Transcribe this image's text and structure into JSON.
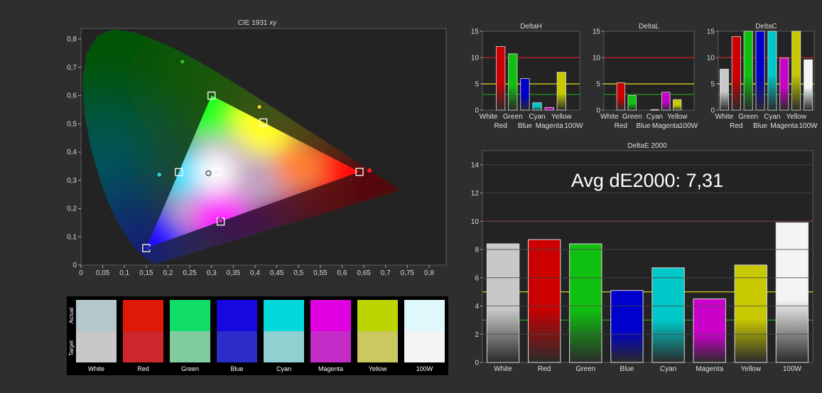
{
  "chart_data": [
    {
      "id": "cie",
      "type": "scatter",
      "title": "CIE 1931 xy",
      "xlim": [
        0,
        0.8
      ],
      "ylim": [
        0,
        0.85
      ],
      "x_ticks": [
        "0",
        "0,05",
        "0,1",
        "0,15",
        "0,2",
        "0,25",
        "0,3",
        "0,35",
        "0,4",
        "0,45",
        "0,5",
        "0,55",
        "0,6",
        "0,65",
        "0,7",
        "0,75",
        "0,8"
      ],
      "y_ticks": [
        "0",
        "0,1",
        "0,2",
        "0,3",
        "0,4",
        "0,5",
        "0,6",
        "0,7",
        "0,8"
      ],
      "gamut_triangle": [
        [
          0.64,
          0.33
        ],
        [
          0.3,
          0.6
        ],
        [
          0.15,
          0.06
        ]
      ],
      "targets": [
        {
          "name": "Red",
          "x": 0.64,
          "y": 0.33
        },
        {
          "name": "Green",
          "x": 0.3,
          "y": 0.6
        },
        {
          "name": "Blue",
          "x": 0.15,
          "y": 0.06
        },
        {
          "name": "Cyan",
          "x": 0.225,
          "y": 0.329
        },
        {
          "name": "Magenta",
          "x": 0.321,
          "y": 0.154
        },
        {
          "name": "Yellow",
          "x": 0.419,
          "y": 0.505
        },
        {
          "name": "White",
          "x": 0.3127,
          "y": 0.329
        }
      ],
      "measured": [
        {
          "name": "Red",
          "x": 0.663,
          "y": 0.335,
          "color": "#ff2020"
        },
        {
          "name": "Green",
          "x": 0.233,
          "y": 0.72,
          "color": "#20c020"
        },
        {
          "name": "Blue",
          "x": 0.153,
          "y": 0.06,
          "color": "#2020ff"
        },
        {
          "name": "Cyan",
          "x": 0.18,
          "y": 0.32,
          "color": "#20d0d0"
        },
        {
          "name": "Magenta",
          "x": 0.32,
          "y": 0.158,
          "color": "#e020e0"
        },
        {
          "name": "Yellow",
          "x": 0.41,
          "y": 0.56,
          "color": "#d0d020"
        },
        {
          "name": "White",
          "x": 0.293,
          "y": 0.325,
          "color": "#e8e8e8"
        }
      ]
    },
    {
      "id": "deltaH",
      "type": "bar",
      "title": "DeltaH",
      "ylim": [
        0,
        15
      ],
      "y_ticks": [
        "0",
        "5",
        "10",
        "15"
      ],
      "categories": [
        "White",
        "Red",
        "Green",
        "Blue",
        "Cyan",
        "Magenta",
        "Yellow",
        "100W"
      ],
      "values": [
        0,
        12.1,
        10.7,
        6.0,
        1.4,
        0.5,
        7.2,
        0
      ],
      "thresholds": [
        10,
        5,
        3
      ]
    },
    {
      "id": "deltaL",
      "type": "bar",
      "title": "DeltaL",
      "ylim": [
        0,
        15
      ],
      "y_ticks": [
        "0",
        "5",
        "10",
        "15"
      ],
      "categories": [
        "White",
        "Red",
        "Green",
        "Blue",
        "Cyan",
        "Magenta",
        "Yellow",
        "100W"
      ],
      "values": [
        0,
        5.2,
        2.8,
        0,
        0.1,
        3.4,
        2.0,
        0
      ],
      "thresholds": [
        10,
        5,
        3
      ]
    },
    {
      "id": "deltaC",
      "type": "bar",
      "title": "DeltaC",
      "ylim": [
        0,
        15
      ],
      "y_ticks": [
        "0",
        "5",
        "10",
        "15"
      ],
      "categories": [
        "White",
        "Red",
        "Green",
        "Blue",
        "Cyan",
        "Magenta",
        "Yellow",
        "100W"
      ],
      "values": [
        7.8,
        14.0,
        15.0,
        15.0,
        15.0,
        9.9,
        15.0,
        9.6
      ],
      "thresholds": [
        10,
        5,
        3
      ]
    },
    {
      "id": "deltaE",
      "type": "bar",
      "title": "DeltaE 2000",
      "annotation": "Avg dE2000: 7,31",
      "ylim": [
        0,
        15
      ],
      "y_ticks": [
        "0",
        "2",
        "4",
        "6",
        "8",
        "10",
        "12",
        "14"
      ],
      "categories": [
        "White",
        "Red",
        "Green",
        "Blue",
        "Cyan",
        "Magenta",
        "Yellow",
        "100W"
      ],
      "values": [
        8.4,
        8.7,
        8.4,
        5.1,
        6.7,
        4.5,
        6.9,
        9.9
      ],
      "thresholds": [
        10,
        5,
        3
      ]
    }
  ],
  "colors": {
    "White": "#c8c8c8",
    "Red": "#cc0000",
    "Green": "#10c010",
    "Blue": "#0000cc",
    "Cyan": "#00c8c8",
    "Magenta": "#c800c8",
    "Yellow": "#c8c800",
    "100W": "#f4f4f4",
    "threshold_high": "#cc2020",
    "threshold_mid": "#e0e020",
    "threshold_low": "#20a020"
  },
  "swatches": {
    "side_actual": "Actual",
    "side_target": "Target",
    "items": [
      {
        "label": "White",
        "actual": "#b4c8cc",
        "target": "#c8c8c8"
      },
      {
        "label": "Red",
        "actual": "#e01808",
        "target": "#cc282c"
      },
      {
        "label": "Green",
        "actual": "#10dc68",
        "target": "#80cca0"
      },
      {
        "label": "Blue",
        "actual": "#1808e0",
        "target": "#2c2cc8"
      },
      {
        "label": "Cyan",
        "actual": "#00d8dc",
        "target": "#90d0d0"
      },
      {
        "label": "Magenta",
        "actual": "#e000e0",
        "target": "#c42cc8"
      },
      {
        "label": "Yellow",
        "actual": "#bcd400",
        "target": "#ccc860"
      },
      {
        "label": "100W",
        "actual": "#e0f8fc",
        "target": "#f4f4f4"
      }
    ]
  }
}
